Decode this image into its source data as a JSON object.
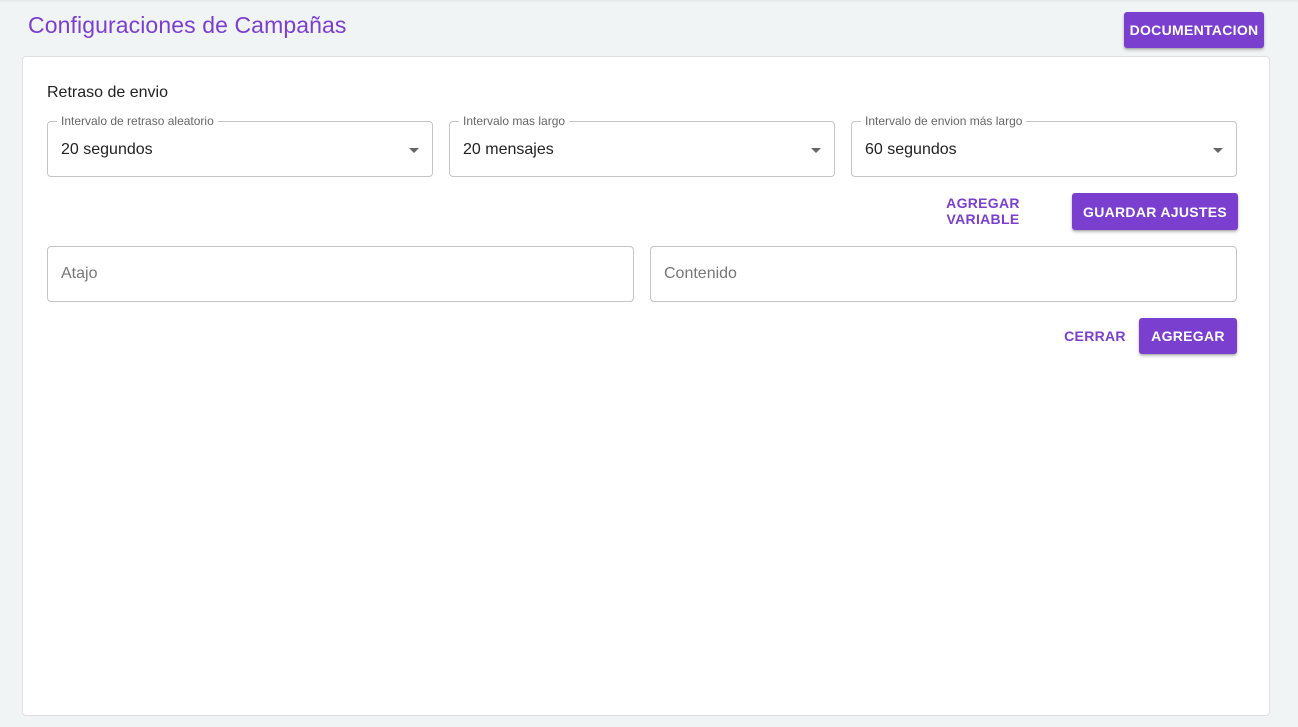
{
  "header": {
    "title": "Configuraciones de Campañas",
    "documentation_button": "DOCUMENTACION"
  },
  "settings": {
    "section_label": "Retraso de envio",
    "selects": [
      {
        "label": "Intervalo de retraso aleatorio",
        "value": "20 segundos"
      },
      {
        "label": "Intervalo mas largo",
        "value": "20 mensajes"
      },
      {
        "label": "Intervalo de envion más largo",
        "value": "60 segundos"
      }
    ],
    "add_variable_button": "AGREGAR VARIABLE",
    "save_button": "GUARDAR AJUSTES"
  },
  "shortcut_form": {
    "shortcut_placeholder": "Atajo",
    "content_placeholder": "Contenido",
    "close_button": "CERRAR",
    "add_button": "AGREGAR"
  },
  "colors": {
    "accent": "#7b3fd0",
    "background": "#f1f4f5",
    "card": "#ffffff",
    "border": "#c4c4c4"
  },
  "icons": {
    "select_arrow": "arrow-drop-down-icon"
  }
}
